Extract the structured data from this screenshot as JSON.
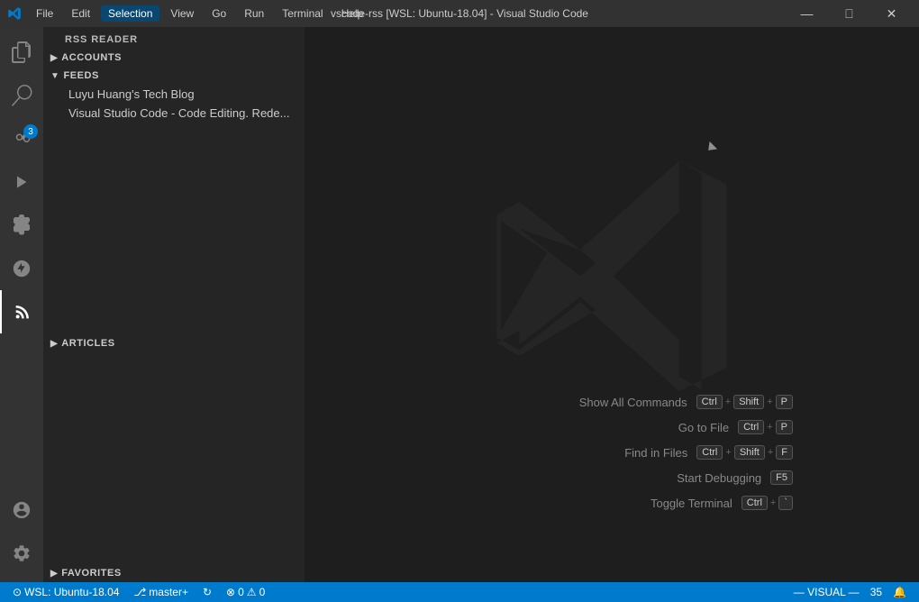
{
  "titlebar": {
    "title": "vscode-rss [WSL: Ubuntu-18.04] - Visual Studio Code",
    "menu": [
      "File",
      "Edit",
      "Selection",
      "View",
      "Go",
      "Run",
      "Terminal",
      "Help"
    ],
    "active_menu": "Selection",
    "win_buttons": [
      "minimize",
      "maximize",
      "close"
    ]
  },
  "activity_bar": {
    "icons": [
      {
        "name": "explorer-icon",
        "symbol": "⎘",
        "active": false
      },
      {
        "name": "search-icon",
        "symbol": "🔍",
        "active": false
      },
      {
        "name": "source-control-icon",
        "symbol": "⑂",
        "active": false,
        "badge": "3"
      },
      {
        "name": "run-icon",
        "symbol": "▷",
        "active": false
      },
      {
        "name": "extensions-icon",
        "symbol": "⊞",
        "active": false
      },
      {
        "name": "remote-icon",
        "symbol": "⊙",
        "active": false
      },
      {
        "name": "rss-icon",
        "symbol": "📡",
        "active": true
      }
    ],
    "bottom": [
      {
        "name": "accounts-icon",
        "symbol": "👤"
      },
      {
        "name": "settings-icon",
        "symbol": "⚙"
      }
    ]
  },
  "sidebar": {
    "title": "RSS READER",
    "sections": {
      "accounts": {
        "label": "ACCOUNTS",
        "expanded": false
      },
      "feeds": {
        "label": "FEEDS",
        "expanded": true,
        "items": [
          "Luyu Huang's Tech Blog",
          "Visual Studio Code - Code Editing. Rede..."
        ]
      },
      "articles": {
        "label": "ARTICLES",
        "expanded": false
      },
      "favorites": {
        "label": "FAVORITES",
        "expanded": false
      }
    }
  },
  "editor": {
    "shortcuts": [
      {
        "label": "Show All Commands",
        "keys": [
          "Ctrl",
          "+",
          "Shift",
          "+",
          "P"
        ]
      },
      {
        "label": "Go to File",
        "keys": [
          "Ctrl",
          "+",
          "P"
        ]
      },
      {
        "label": "Find in Files",
        "keys": [
          "Ctrl",
          "+",
          "Shift",
          "+",
          "F"
        ]
      },
      {
        "label": "Start Debugging",
        "keys": [
          "F5"
        ]
      },
      {
        "label": "Toggle Terminal",
        "keys": [
          "Ctrl",
          "+",
          "`"
        ]
      }
    ]
  },
  "statusbar": {
    "left": [
      {
        "text": "⊙ WSL: Ubuntu-18.04",
        "name": "wsl-status"
      },
      {
        "text": "⎇ master+",
        "name": "git-branch"
      },
      {
        "text": "↻",
        "name": "sync-icon"
      },
      {
        "text": "⊗ 0  ⚠ 0",
        "name": "errors-warnings"
      }
    ],
    "right": [
      {
        "text": "— VISUAL —",
        "name": "vim-mode"
      },
      {
        "text": "35",
        "name": "line-col"
      },
      {
        "text": "🔔",
        "name": "notification-icon"
      }
    ]
  }
}
